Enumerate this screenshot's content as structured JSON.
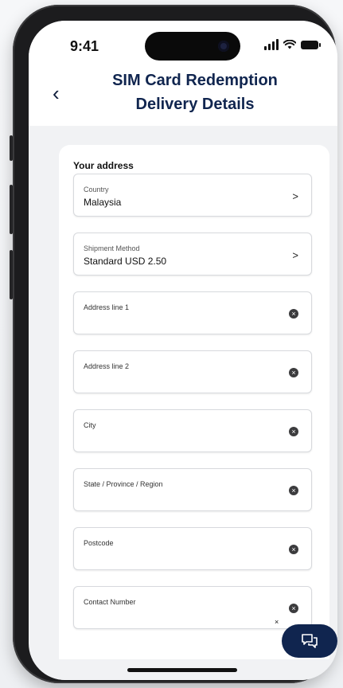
{
  "status_bar": {
    "time": "9:41"
  },
  "header": {
    "title_line1": "SIM Card Redemption",
    "title_line2": "Delivery Details"
  },
  "form": {
    "section_title": "Your address",
    "fields": [
      {
        "label": "Country",
        "value": "Malaysia",
        "type": "select"
      },
      {
        "label": "Shipment Method",
        "value": "Standard USD 2.50",
        "type": "select"
      },
      {
        "label": "Address line 1",
        "value": "",
        "type": "text"
      },
      {
        "label": "Address line 2",
        "value": "",
        "type": "text"
      },
      {
        "label": "City",
        "value": "",
        "type": "text"
      },
      {
        "label": "State / Province / Region",
        "value": "",
        "type": "text"
      },
      {
        "label": "Postcode",
        "value": "",
        "type": "text"
      },
      {
        "label": "Contact Number",
        "value": "",
        "type": "text"
      }
    ]
  },
  "icons": {
    "back": "chevron-left-icon",
    "chevron": "chevron-right-icon",
    "clear": "clear-circle-icon",
    "chat": "chat-bubbles-icon"
  },
  "colors": {
    "brand_navy": "#10254f",
    "background": "#f1f2f4"
  }
}
